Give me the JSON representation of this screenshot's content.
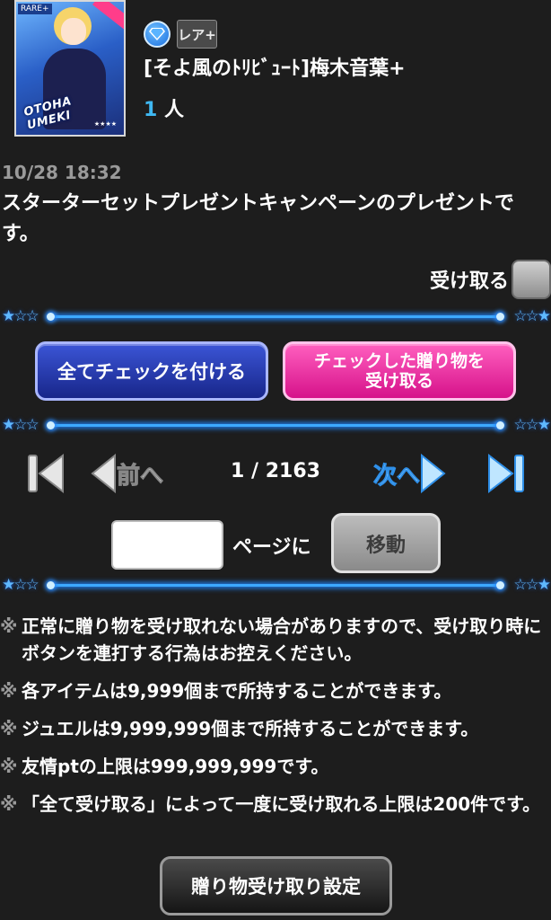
{
  "card": {
    "thumb_name": "OTOHA UMEKI",
    "rank_badge": "RARE+",
    "rarity_badge": "レア+",
    "name": "[そよ風のﾄﾘﾋﾞｭｰﾄ]梅木音葉+",
    "count_num": "1",
    "count_unit": " 人"
  },
  "timestamp": "10/28 18:32",
  "message": "スターターセットプレゼントキャンペーンのプレゼントです。",
  "receive": {
    "label": "受け取る",
    "checked": false
  },
  "buttons": {
    "check_all": "全てチェックを付ける",
    "receive_checked_line1": "チェックした贈り物を",
    "receive_checked_line2": "受け取る"
  },
  "pagination": {
    "prev": "前へ",
    "next": "次へ",
    "indicator": "1 / 2163",
    "input_value": "",
    "suffix": "ページに",
    "move": "移動"
  },
  "notes": {
    "mark": "※",
    "items": [
      "正常に贈り物を受け取れない場合がありますので、受け取り時にボタンを連打する行為はお控えください。",
      "各アイテムは9,999個まで所持することができます。",
      "ジュエルは9,999,999個まで所持することができます。",
      "友情ptの上限は999,999,999です。",
      "「全て受け取る」によって一度に受け取れる上限は200件です。"
    ]
  },
  "settings_button": "贈り物受け取り設定"
}
